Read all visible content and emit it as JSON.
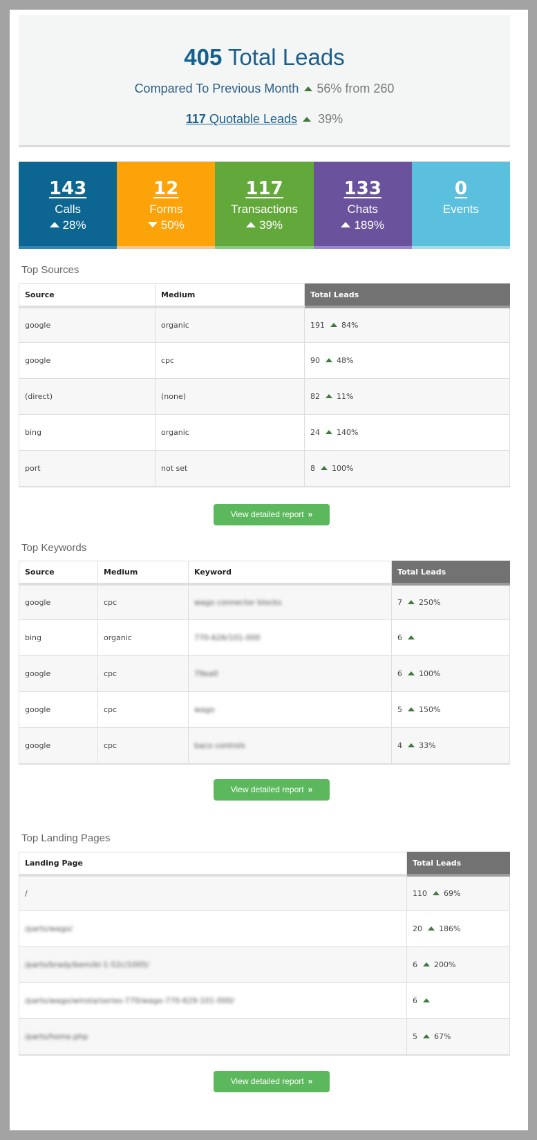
{
  "summary": {
    "total_value": "405",
    "total_label": "Total Leads",
    "compare_label": "Compared To Previous Month",
    "compare_delta": "56% from 260",
    "compare_direction": "up",
    "quotable_value": "117",
    "quotable_label": "Quotable Leads",
    "quotable_delta": "39%",
    "quotable_direction": "up"
  },
  "stats": [
    {
      "value": "143",
      "label": "Calls",
      "change": "28%",
      "direction": "up",
      "color": "#0d6591",
      "stripe": "#2b87b8"
    },
    {
      "value": "12",
      "label": "Forms",
      "change": "50%",
      "direction": "down",
      "color": "#fda30a",
      "stripe": "#f6c58d"
    },
    {
      "value": "117",
      "label": "Transactions",
      "change": "39%",
      "direction": "up",
      "color": "#63a83b",
      "stripe": "#84cd7c"
    },
    {
      "value": "133",
      "label": "Chats",
      "change": "189%",
      "direction": "up",
      "color": "#6a529d",
      "stripe": "#9b86d4"
    },
    {
      "value": "0",
      "label": "Events",
      "change": "",
      "direction": "none",
      "color": "#5bbfde",
      "stripe": "#a7dbe8"
    }
  ],
  "top_sources": {
    "title": "Top Sources",
    "columns": [
      "Source",
      "Medium",
      "Total Leads"
    ],
    "rows": [
      {
        "source": "google",
        "medium": "organic",
        "leads": "191",
        "change": "84%"
      },
      {
        "source": "google",
        "medium": "cpc",
        "leads": "90",
        "change": "48%"
      },
      {
        "source": "(direct)",
        "medium": "(none)",
        "leads": "82",
        "change": "11%"
      },
      {
        "source": "bing",
        "medium": "organic",
        "leads": "24",
        "change": "140%"
      },
      {
        "source": "port",
        "medium": "not set",
        "leads": "8",
        "change": "100%"
      }
    ],
    "button_label": "View detailed report",
    "button_icon": "»"
  },
  "top_keywords": {
    "title": "Top Keywords",
    "columns": [
      "Source",
      "Medium",
      "Keyword",
      "Total Leads"
    ],
    "rows": [
      {
        "source": "google",
        "medium": "cpc",
        "keyword": "wago connector blocks",
        "leads": "7",
        "change": "250%"
      },
      {
        "source": "bing",
        "medium": "organic",
        "keyword": "770-626/101-000",
        "leads": "6",
        "change": ""
      },
      {
        "source": "google",
        "medium": "cpc",
        "keyword": "79ea0",
        "leads": "6",
        "change": "100%"
      },
      {
        "source": "google",
        "medium": "cpc",
        "keyword": "wago",
        "leads": "5",
        "change": "150%"
      },
      {
        "source": "google",
        "medium": "cpc",
        "keyword": "baco controls",
        "leads": "4",
        "change": "33%"
      }
    ],
    "button_label": "View detailed report",
    "button_icon": "»"
  },
  "top_landing_pages": {
    "title": "Top Landing Pages",
    "columns": [
      "Landing Page",
      "Total Leads"
    ],
    "rows": [
      {
        "page": "/",
        "leads": "110",
        "change": "69%",
        "blurred": false
      },
      {
        "page": "/parts/wago/",
        "leads": "20",
        "change": "186%",
        "blurred": true
      },
      {
        "page": "/parts/brady/bem/bl-1-52c/1005/",
        "leads": "6",
        "change": "200%",
        "blurred": true
      },
      {
        "page": "/parts/wago/winsta/series-770/wago-770-629-101-000/",
        "leads": "6",
        "change": "",
        "blurred": true
      },
      {
        "page": "/parts/home.php",
        "leads": "5",
        "change": "67%",
        "blurred": true
      }
    ],
    "button_label": "View detailed report",
    "button_icon": "»"
  },
  "colors": {
    "accent_blue": "#1a5e8d",
    "up_arrow": "#3f7a3c",
    "button_green": "#5cb85c",
    "header_dark": "#727272"
  }
}
